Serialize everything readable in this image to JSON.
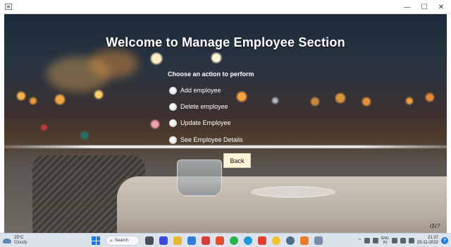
{
  "window": {
    "minimize_glyph": "—",
    "maximize_glyph": "☐",
    "close_glyph": "✕"
  },
  "main": {
    "title": "Welcome to Manage Employee Section",
    "prompt": "Choose an action to perform",
    "options": [
      {
        "label": "Add employee"
      },
      {
        "label": "Delete employee"
      },
      {
        "label": "Update Employee"
      },
      {
        "label": "See Employee Details"
      }
    ],
    "back_label": "Back"
  },
  "taskbar": {
    "weather_temp": "25°C",
    "weather_desc": "Cloudy",
    "search_label": "Search",
    "lang_line1": "ENG",
    "lang_line2": "IN",
    "time": "21:37",
    "date": "23-11-2022",
    "apps": [
      {
        "icon": "start-menu-icon",
        "color": "#1f7ae0"
      },
      {
        "icon": "task-view-icon",
        "color": "#4a4f57"
      },
      {
        "icon": "camera-app-icon",
        "color": "#3b4ad8"
      },
      {
        "icon": "file-explorer-icon",
        "color": "#e8b631"
      },
      {
        "icon": "notes-app-icon",
        "color": "#2f7fd8"
      },
      {
        "icon": "store-app-icon",
        "color": "#d83b3b"
      },
      {
        "icon": "office-app-icon",
        "color": "#e34c2d"
      },
      {
        "icon": "whatsapp-icon",
        "color": "#25b34b"
      },
      {
        "icon": "edge-browser-icon",
        "color": "#1e9ad6"
      },
      {
        "icon": "app-red-icon",
        "color": "#e0412f"
      },
      {
        "icon": "chrome-browser-icon",
        "color": "#f1c232"
      },
      {
        "icon": "settings-icon",
        "color": "#4f6e8d"
      },
      {
        "icon": "app-colorful-icon",
        "color": "#e87c2b"
      },
      {
        "icon": "java-app-icon",
        "color": "#7b8ba8"
      }
    ]
  },
  "colors": {
    "back_button_bg": "#fff4d6",
    "taskbar_bg": "#dce3ec",
    "accent": "#1f7ae0"
  }
}
